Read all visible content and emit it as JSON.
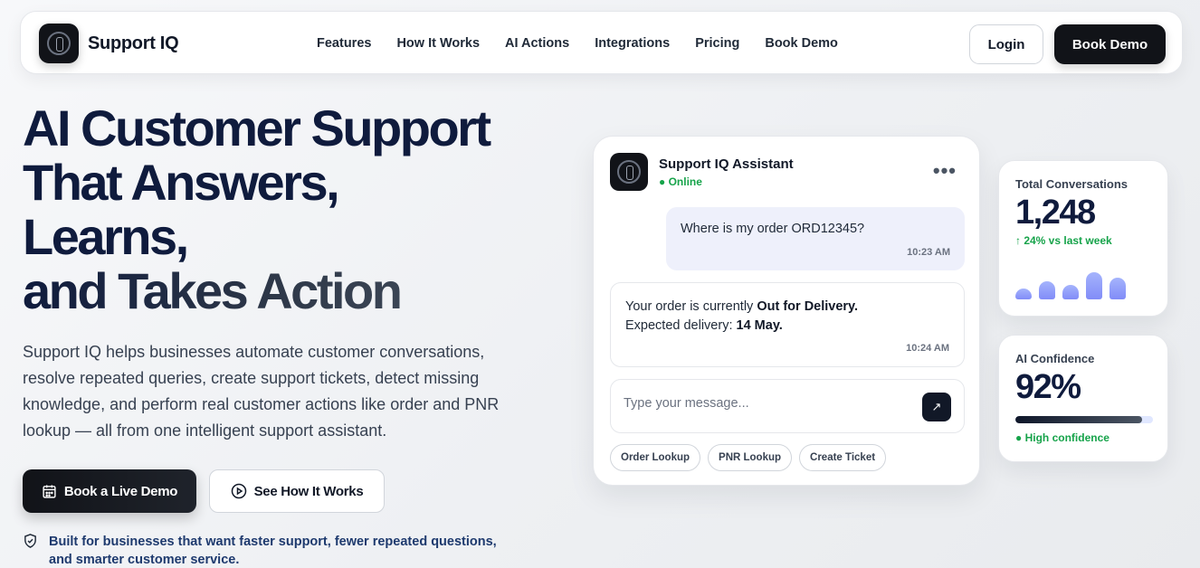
{
  "brand": {
    "name": "Support IQ"
  },
  "nav": {
    "links": [
      "Features",
      "How It Works",
      "AI Actions",
      "Integrations",
      "Pricing",
      "Book Demo"
    ],
    "login": "Login",
    "cta": "Book Demo"
  },
  "hero": {
    "title_lines": [
      "AI Customer Support",
      "That Answers,",
      "Learns,",
      "and Takes Action"
    ],
    "description": "Support IQ helps businesses automate customer conversations, resolve repeated queries, create support tickets, detect missing knowledge, and perform real customer actions like order and PNR lookup — all from one intelligent support assistant.",
    "primary_button": "Book a Live Demo",
    "secondary_button": "See How It Works",
    "trust_text": "Built for businesses that want faster support, fewer repeated questions, and smarter customer service."
  },
  "chat": {
    "title": "Support IQ Assistant",
    "status": "● Online",
    "user_message": {
      "text": "Where is my order ORD12345?",
      "time": "10:23 AM"
    },
    "bot_message": {
      "line1_prefix": "Your order is currently ",
      "line1_bold": "Out for Delivery.",
      "line2_prefix": "Expected delivery: ",
      "line2_bold": "14 May.",
      "time": "10:24 AM"
    },
    "input_placeholder": "Type your message...",
    "chips": [
      "Order Lookup",
      "PNR Lookup",
      "Create Ticket"
    ]
  },
  "stats": {
    "conversations": {
      "label": "Total Conversations",
      "value": "1,248",
      "trend": "↑ 24% vs last week",
      "bar_levels": [
        0.38,
        0.62,
        0.5,
        0.95,
        0.75
      ]
    },
    "confidence": {
      "label": "AI Confidence",
      "value": "92%",
      "level": 0.92,
      "status": "● High confidence"
    }
  },
  "colors": {
    "accent_dark": "#111318",
    "success": "#16a34a",
    "bubble_user": "#eef0fb",
    "bar": "#818cf8"
  },
  "icons": [
    "logo-icon",
    "calendar-icon",
    "play-circle-icon",
    "shield-icon",
    "more-dots-icon",
    "send-arrow-icon"
  ]
}
